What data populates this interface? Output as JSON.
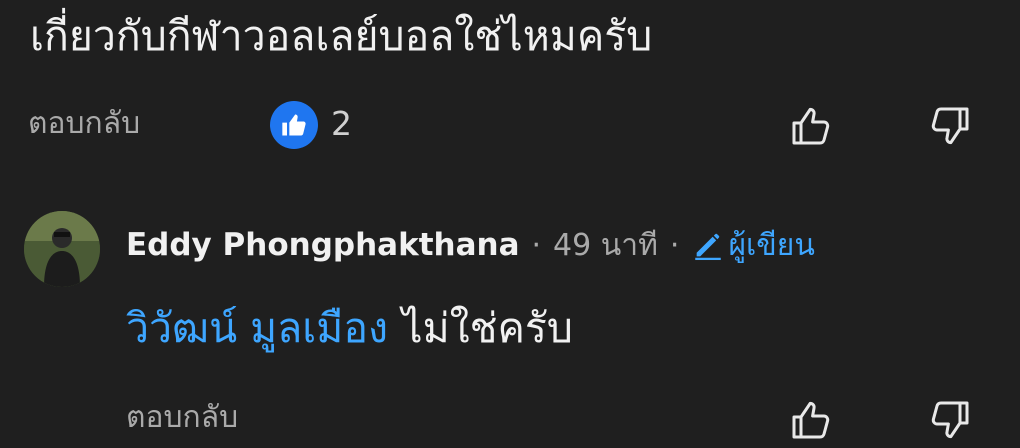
{
  "parent_comment": {
    "text": "เกี่ยวกับกีฬาวอลเลย์บอลใช่ไหมครับ",
    "reply_label": "ตอบกลับ",
    "like_count": "2",
    "icons": {
      "like_badge": "thumbs-up-icon",
      "like": "thumb-up-outline-icon",
      "dislike": "thumb-down-outline-icon"
    }
  },
  "reply_comment": {
    "author": "Eddy Phongphakthana",
    "separator": "·",
    "timestamp": "49 นาที",
    "author_badge_label": "ผู้เขียน",
    "mention": "วิวัฒน์ มูลเมือง",
    "text": "ไม่ใช่ครับ",
    "reply_label": "ตอบกลับ",
    "icons": {
      "avatar": "avatar-icon",
      "author_badge": "pencil-icon",
      "like": "thumb-up-outline-icon",
      "dislike": "thumb-down-outline-icon"
    }
  },
  "colors": {
    "background": "#1f1f1f",
    "text": "#f1f1f1",
    "secondary_text": "#aaaaaa",
    "link": "#3ea6ff",
    "like_badge": "#1f76f0"
  }
}
